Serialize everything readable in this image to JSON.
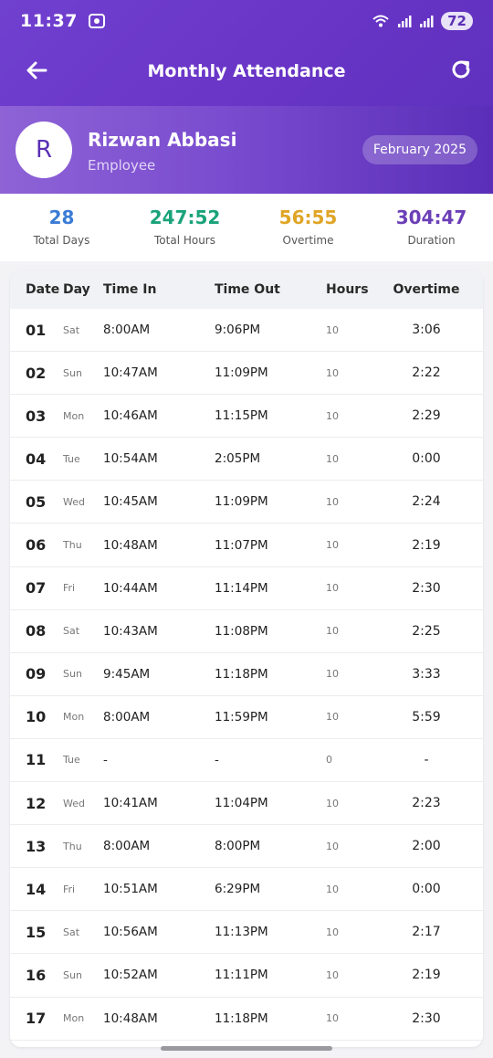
{
  "status_bar": {
    "time": "11:37",
    "signal_text": "◆³ ▎▉ ▎▉",
    "battery": "72"
  },
  "app_bar": {
    "title": "Monthly Attendance"
  },
  "profile": {
    "initial": "R",
    "name": "Rizwan Abbasi",
    "role": "Employee",
    "month": "February 2025"
  },
  "summary": [
    {
      "value": "28",
      "label": "Total Days",
      "color": "#3a7bd5"
    },
    {
      "value": "247:52",
      "label": "Total Hours",
      "color": "#1aa37a"
    },
    {
      "value": "56:55",
      "label": "Overtime",
      "color": "#e0a526"
    },
    {
      "value": "304:47",
      "label": "Duration",
      "color": "#6b3fb7"
    }
  ],
  "table": {
    "headers": {
      "date": "Date",
      "day": "Day",
      "time_in": "Time In",
      "time_out": "Time Out",
      "hours": "Hours",
      "overtime": "Overtime"
    },
    "rows": [
      {
        "date": "01",
        "day": "Sat",
        "time_in": "8:00AM",
        "time_out": "9:06PM",
        "hours": "10",
        "overtime": "3:06"
      },
      {
        "date": "02",
        "day": "Sun",
        "time_in": "10:47AM",
        "time_out": "11:09PM",
        "hours": "10",
        "overtime": "2:22"
      },
      {
        "date": "03",
        "day": "Mon",
        "time_in": "10:46AM",
        "time_out": "11:15PM",
        "hours": "10",
        "overtime": "2:29"
      },
      {
        "date": "04",
        "day": "Tue",
        "time_in": "10:54AM",
        "time_out": "2:05PM",
        "hours": "10",
        "overtime": "0:00"
      },
      {
        "date": "05",
        "day": "Wed",
        "time_in": "10:45AM",
        "time_out": "11:09PM",
        "hours": "10",
        "overtime": "2:24"
      },
      {
        "date": "06",
        "day": "Thu",
        "time_in": "10:48AM",
        "time_out": "11:07PM",
        "hours": "10",
        "overtime": "2:19"
      },
      {
        "date": "07",
        "day": "Fri",
        "time_in": "10:44AM",
        "time_out": "11:14PM",
        "hours": "10",
        "overtime": "2:30"
      },
      {
        "date": "08",
        "day": "Sat",
        "time_in": "10:43AM",
        "time_out": "11:08PM",
        "hours": "10",
        "overtime": "2:25"
      },
      {
        "date": "09",
        "day": "Sun",
        "time_in": "9:45AM",
        "time_out": "11:18PM",
        "hours": "10",
        "overtime": "3:33"
      },
      {
        "date": "10",
        "day": "Mon",
        "time_in": "8:00AM",
        "time_out": "11:59PM",
        "hours": "10",
        "overtime": "5:59"
      },
      {
        "date": "11",
        "day": "Tue",
        "time_in": "-",
        "time_out": "-",
        "hours": "0",
        "overtime": "-"
      },
      {
        "date": "12",
        "day": "Wed",
        "time_in": "10:41AM",
        "time_out": "11:04PM",
        "hours": "10",
        "overtime": "2:23"
      },
      {
        "date": "13",
        "day": "Thu",
        "time_in": "8:00AM",
        "time_out": "8:00PM",
        "hours": "10",
        "overtime": "2:00"
      },
      {
        "date": "14",
        "day": "Fri",
        "time_in": "10:51AM",
        "time_out": "6:29PM",
        "hours": "10",
        "overtime": "0:00"
      },
      {
        "date": "15",
        "day": "Sat",
        "time_in": "10:56AM",
        "time_out": "11:13PM",
        "hours": "10",
        "overtime": "2:17"
      },
      {
        "date": "16",
        "day": "Sun",
        "time_in": "10:52AM",
        "time_out": "11:11PM",
        "hours": "10",
        "overtime": "2:19"
      },
      {
        "date": "17",
        "day": "Mon",
        "time_in": "10:48AM",
        "time_out": "11:18PM",
        "hours": "10",
        "overtime": "2:30"
      }
    ]
  },
  "icons": {
    "back": "back-arrow-icon",
    "refresh": "refresh-icon",
    "screen_record": "screen-record-icon"
  },
  "colors": {
    "primary": "#6a36c8",
    "profile_gradient_end": "#5a2eb8"
  }
}
